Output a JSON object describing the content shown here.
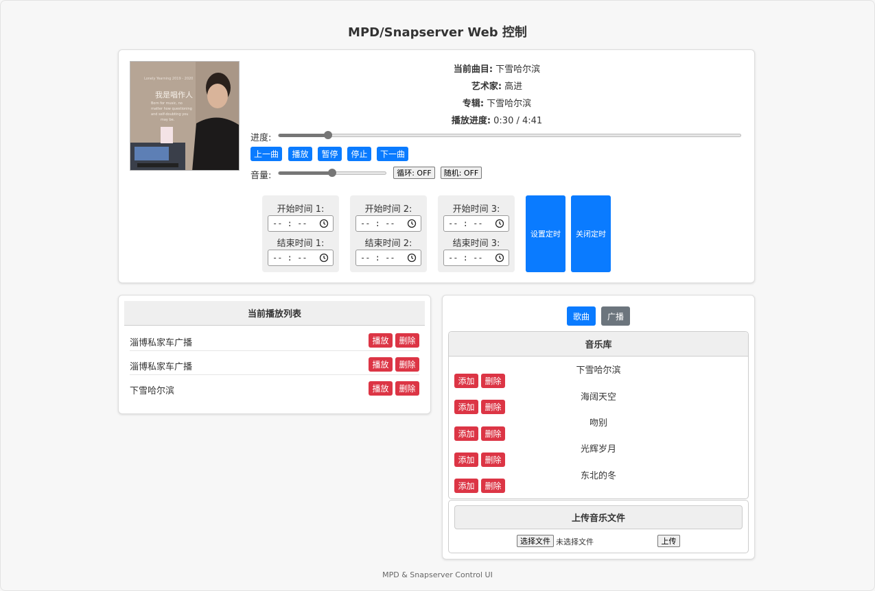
{
  "title": "MPD/Snapserver Web 控制",
  "now_playing": {
    "track_label": "当前曲目:",
    "track": "下雪哈尔滨",
    "artist_label": "艺术家:",
    "artist": "高进",
    "album_label": "专辑:",
    "album": "下雪哈尔滨",
    "progress_label": "播放进度:",
    "progress": "0:30 / 4:41",
    "progress_fraction": 0.107
  },
  "album_art": {
    "title": "我是唱作人",
    "line1": "Born for music, no",
    "line2": "matter how questioning",
    "line3": "and self-doubting you",
    "line4": "may be.",
    "top_tag": "Lonely Yearning 2019 - 2020"
  },
  "controls": {
    "seek_label": "进度:",
    "prev": "上一曲",
    "play": "播放",
    "pause": "暂停",
    "stop": "停止",
    "next": "下一曲",
    "volume_label": "音量:",
    "volume_fraction": 0.5,
    "repeat": "循环: OFF",
    "random": "随机: OFF"
  },
  "timers": [
    {
      "start_label": "开始时间 1:",
      "start_value": "-- : --",
      "end_label": "结束时间 1:",
      "end_value": "-- : --"
    },
    {
      "start_label": "开始时间 2:",
      "start_value": "-- : --",
      "end_label": "结束时间 2:",
      "end_value": "-- : --"
    },
    {
      "start_label": "开始时间 3:",
      "start_value": "-- : --",
      "end_label": "结束时间 3:",
      "end_value": "-- : --"
    }
  ],
  "timer_buttons": {
    "set": "设置定时",
    "cancel": "关闭定时"
  },
  "playlist": {
    "header": "当前播放列表",
    "play": "播放",
    "delete": "删除",
    "items": [
      "淄博私家车广播",
      "淄博私家车广播",
      "下雪哈尔滨"
    ]
  },
  "library": {
    "tab_songs": "歌曲",
    "tab_radio": "广播",
    "header": "音乐库",
    "add": "添加",
    "delete": "删除",
    "songs": [
      "下雪哈尔滨",
      "海阔天空",
      "吻别",
      "光辉岁月",
      "东北的冬"
    ]
  },
  "upload": {
    "header": "上传音乐文件",
    "choose": "选择文件",
    "no_file": "未选择文件",
    "upload": "上传"
  },
  "footer": "MPD & Snapserver Control UI",
  "colors": {
    "primary": "#0a7bff",
    "danger": "#dc3545",
    "secondary": "#6c757d"
  }
}
